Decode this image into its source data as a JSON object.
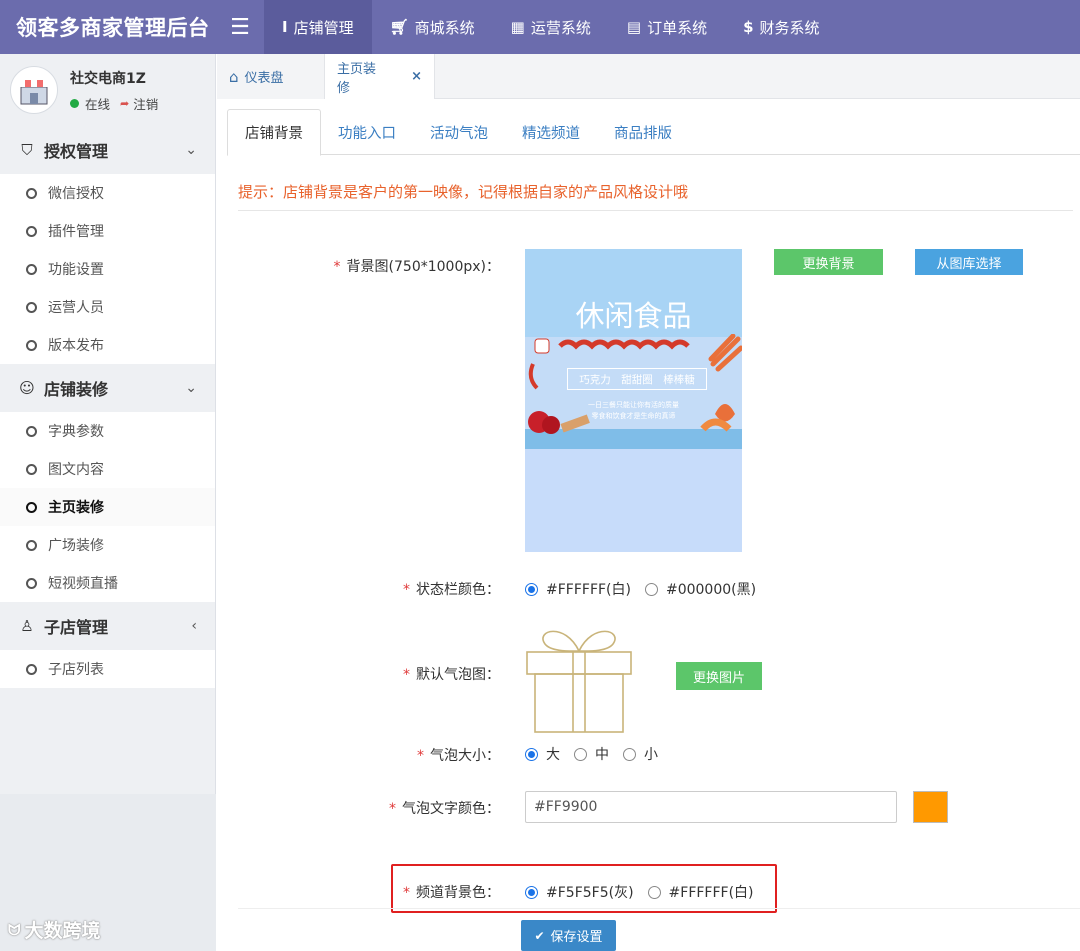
{
  "header": {
    "brand": "领客多商家管理后台",
    "nav": [
      {
        "label": "店铺管理",
        "icon": "text-icon"
      },
      {
        "label": "商城系统",
        "icon": "cart-icon"
      },
      {
        "label": "运营系统",
        "icon": "grid-icon"
      },
      {
        "label": "订单系统",
        "icon": "list-icon"
      },
      {
        "label": "财务系统",
        "icon": "dollar-icon"
      }
    ]
  },
  "sidebar": {
    "user": {
      "name": "社交电商1Z",
      "status": "在线",
      "logout": "注销"
    },
    "groups": [
      {
        "label": "授权管理",
        "items": [
          "微信授权",
          "插件管理",
          "功能设置",
          "运营人员",
          "版本发布"
        ]
      },
      {
        "label": "店铺装修",
        "items": [
          "字典参数",
          "图文内容",
          "主页装修",
          "广场装修",
          "短视频直播"
        ]
      },
      {
        "label": "子店管理",
        "items": [
          "子店列表"
        ]
      }
    ],
    "watermark": "大数跨境"
  },
  "page_tabs": [
    {
      "label": "仪表盘"
    },
    {
      "label": "主页装修",
      "close": "×"
    }
  ],
  "inner_tabs": [
    "店铺背景",
    "功能入口",
    "活动气泡",
    "精选频道",
    "商品排版"
  ],
  "hint": "提示：店铺背景是客户的第一映像，记得根据自家的产品风格设计哦",
  "form": {
    "bg_label": "背景图(750*1000px)：",
    "bg_image": {
      "title": "休闲食品",
      "tags": "巧克力　甜甜圈　棒棒糖",
      "line1": "一日三餐只能让你有活的质量",
      "line2": "零食和饮食才是生命的真谛"
    },
    "change_bg": "更换背景",
    "choose_gallery": "从图库选择",
    "statusbar_label": "状态栏颜色：",
    "statusbar_options": [
      "#FFFFFF(白)",
      "#000000(黑)"
    ],
    "bubble_label": "默认气泡图：",
    "change_image": "更换图片",
    "bubble_size_label": "气泡大小：",
    "bubble_size_options": [
      "大",
      "中",
      "小"
    ],
    "bubble_text_color_label": "气泡文字颜色：",
    "bubble_text_color": "#FF9900",
    "channel_bg_label": "频道背景色：",
    "channel_bg_options": [
      "#F5F5F5(灰)",
      "#FFFFFF(白)"
    ],
    "save": "保存设置"
  },
  "colors": {
    "topbar": "#6b6cad",
    "accent_orange": "#FF9900",
    "hint": "#e8622c",
    "highlight": "#e02020"
  }
}
